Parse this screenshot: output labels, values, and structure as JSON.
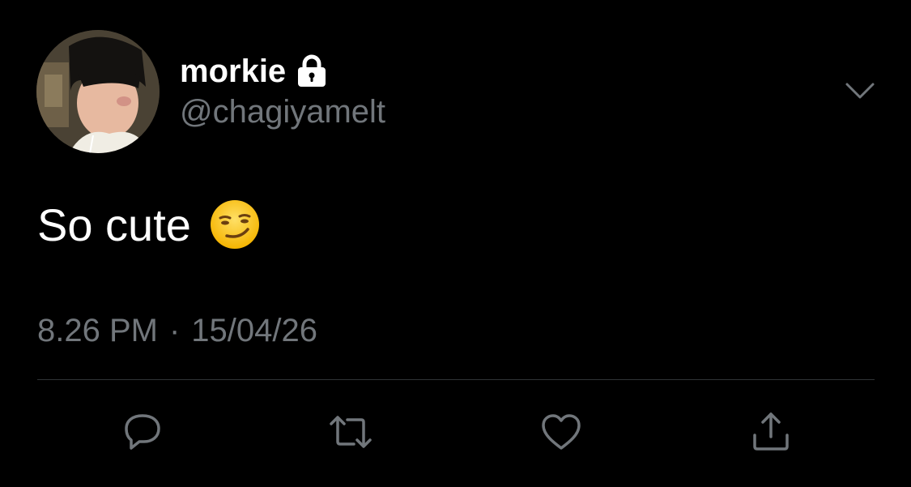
{
  "tweet": {
    "author": {
      "display_name": "morkie",
      "handle": "@chagiyamelt",
      "protected_icon": "lock-icon",
      "avatar": "avatar"
    },
    "menu_icon": "chevron-down-icon",
    "text": "So cute",
    "emoji": "smirking-face-emoji",
    "time": "8.26 PM",
    "separator": "·",
    "date": "15/04/26",
    "actions": [
      {
        "name": "reply",
        "icon": "reply-icon"
      },
      {
        "name": "retweet",
        "icon": "retweet-icon"
      },
      {
        "name": "like",
        "icon": "heart-icon"
      },
      {
        "name": "share",
        "icon": "share-icon"
      }
    ]
  },
  "colors": {
    "background": "#000000",
    "primary_text": "#ffffff",
    "secondary_text": "#71767b",
    "divider": "#2f3336"
  }
}
